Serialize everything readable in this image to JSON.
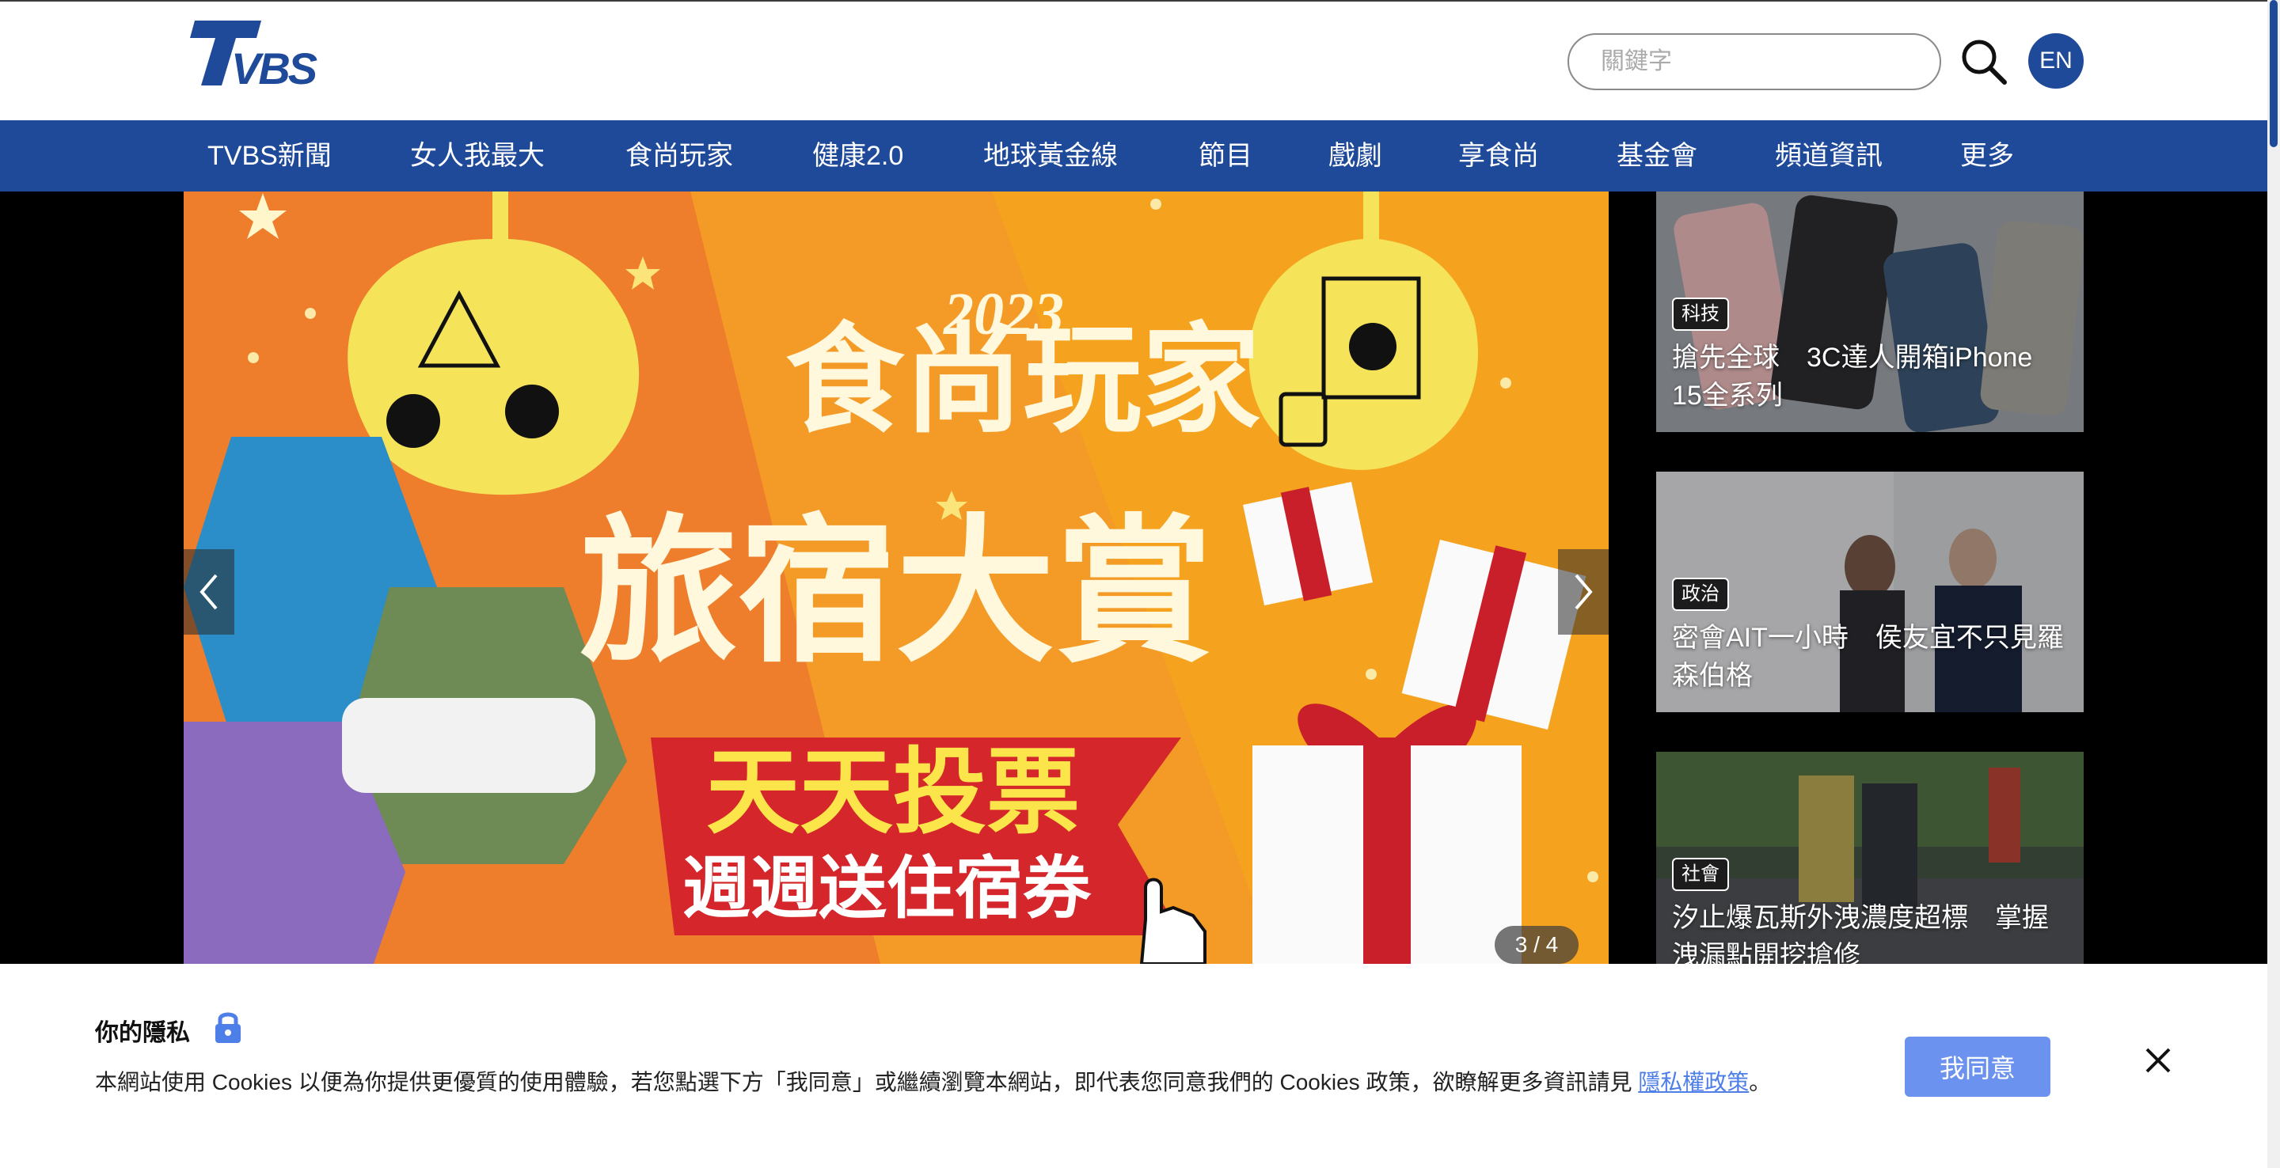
{
  "header": {
    "logo_text": "TVBS",
    "search_placeholder": "關鍵字",
    "lang_label": "EN"
  },
  "nav": {
    "items": [
      {
        "label": "TVBS新聞"
      },
      {
        "label": "女人我最大"
      },
      {
        "label": "食尚玩家"
      },
      {
        "label": "健康2.0"
      },
      {
        "label": "地球黃金線"
      },
      {
        "label": "節目"
      },
      {
        "label": "戲劇"
      },
      {
        "label": "享食尚"
      },
      {
        "label": "基金會"
      },
      {
        "label": "頻道資訊"
      },
      {
        "label": "更多"
      }
    ]
  },
  "banner": {
    "brand": "食尚玩家",
    "year": "2023",
    "headline": "旅宿大賞",
    "ribbon_line1": "天天投票",
    "ribbon_line2": "週週送住宿券",
    "counter": "3 / 4"
  },
  "side_news": [
    {
      "tag": "科技",
      "title": "搶先全球　3C達人開箱iPhone 15全系列"
    },
    {
      "tag": "政治",
      "title": "密會AIT一小時　侯友宜不只見羅森伯格"
    },
    {
      "tag": "社會",
      "title": "汐止爆瓦斯外洩濃度超標　掌握洩漏點開挖搶修"
    }
  ],
  "cookie": {
    "title": "你的隱私",
    "text_before": "本網站使用 Cookies 以便為你提供更優質的使用體驗，若您點選下方「我同意」或繼續瀏覽本網站，即代表您同意我們的 Cookies 政策，欲瞭解更多資訊請見 ",
    "link": "隱私權政策",
    "text_after": "。",
    "agree_label": "我同意"
  },
  "colors": {
    "brand_blue": "#1f4a9a",
    "banner_orange": "#f0802a",
    "ribbon_red": "#d4262b",
    "agree_button": "#6b92ee"
  }
}
